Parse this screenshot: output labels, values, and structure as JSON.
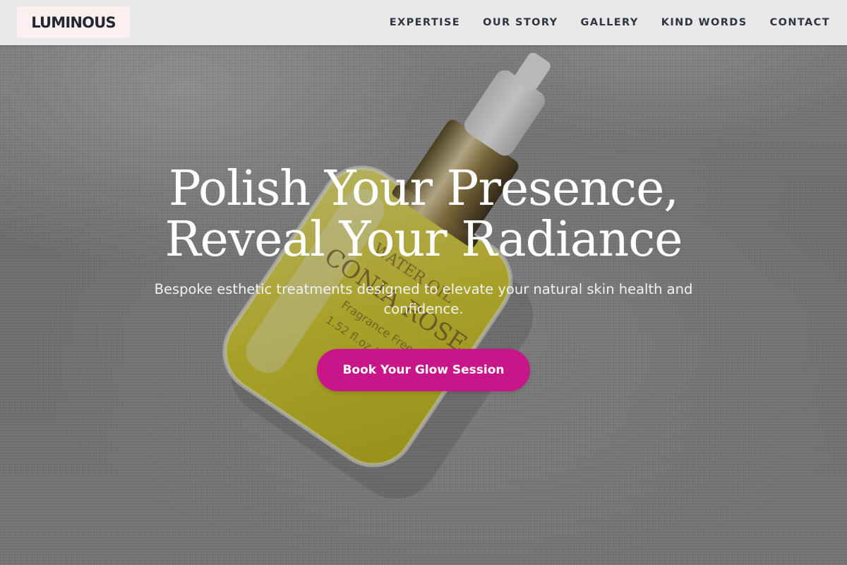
{
  "header": {
    "logo_text": "LUMINOUS",
    "nav": [
      {
        "label": "EXPERTISE"
      },
      {
        "label": "OUR STORY"
      },
      {
        "label": "GALLERY"
      },
      {
        "label": "KIND WORDS"
      },
      {
        "label": "CONTACT"
      }
    ]
  },
  "hero": {
    "title_line_1": "Polish Your Presence,",
    "title_line_2": "Reveal Your Radiance",
    "subtitle": "Bespoke esthetic treatments designed to elevate your natural skin health and confidence.",
    "cta_label": "Book Your Glow Session",
    "background_image": {
      "label_lines": [
        "CONIA ROSE",
        "WATER OIL",
        "Fragrance Free",
        "1.52 fl.oz (45ml)"
      ]
    }
  },
  "colors": {
    "accent": "#c8168a",
    "header_bg": "#e9e9e9",
    "logo_bg": "#fcefef",
    "nav_text": "#2e3440"
  }
}
